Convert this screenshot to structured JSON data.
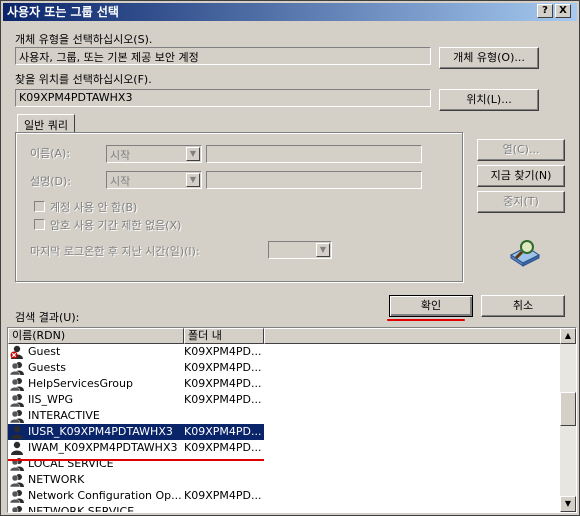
{
  "window": {
    "title": "사용자 또는 그룹 선택",
    "help_btn": "?",
    "close_btn": "X"
  },
  "object_type": {
    "label": "개체 유형을 선택하십시오(S).",
    "value": "사용자, 그룹, 또는 기본 제공 보안 계정",
    "button": "개체 유형(O)..."
  },
  "location": {
    "label": "찾을 위치를 선택하십시오(F).",
    "value": "K09XPM4PDTAWHX3",
    "button": "위치(L)..."
  },
  "query": {
    "tab": "일반 쿼리",
    "name_label": "이름(A):",
    "name_combo": "시작",
    "desc_label": "설명(D):",
    "desc_combo": "시작",
    "disabled_accounts": "계정 사용 안 함(B)",
    "non_expiring": "암호 사용 기간 제한 없음(X)",
    "last_logon": "마지막 로그온한 후 지난 시간(일)(I):"
  },
  "side_buttons": {
    "columns": "열(C)...",
    "find_now": "지금 찾기(N)",
    "stop": "중지(T)"
  },
  "footer": {
    "results_label": "검색 결과(U):",
    "ok": "확인",
    "cancel": "취소"
  },
  "results": {
    "columns": [
      "이름(RDN)",
      "폴더 내"
    ],
    "rows": [
      {
        "name": "Guest",
        "folder": "K09XPM4PD...",
        "icon": "user-disabled-icon"
      },
      {
        "name": "Guests",
        "folder": "K09XPM4PD...",
        "icon": "group-icon"
      },
      {
        "name": "HelpServicesGroup",
        "folder": "K09XPM4PD...",
        "icon": "group-icon"
      },
      {
        "name": "IIS_WPG",
        "folder": "K09XPM4PD...",
        "icon": "group-icon"
      },
      {
        "name": "INTERACTIVE",
        "folder": "",
        "icon": "group-icon"
      },
      {
        "name": "IUSR_K09XPM4PDTAWHX3",
        "folder": "K09XPM4PD...",
        "icon": "user-icon",
        "selected": true
      },
      {
        "name": "IWAM_K09XPM4PDTAWHX3",
        "folder": "K09XPM4PD...",
        "icon": "user-icon"
      },
      {
        "name": "LOCAL SERVICE",
        "folder": "",
        "icon": "group-icon"
      },
      {
        "name": "NETWORK",
        "folder": "",
        "icon": "group-icon"
      },
      {
        "name": "Network Configuration Op...",
        "folder": "K09XPM4PD...",
        "icon": "group-icon"
      },
      {
        "name": "NETWORK SERVICE",
        "folder": "",
        "icon": "group-icon"
      }
    ]
  },
  "colors": {
    "selection": "#0a246a",
    "annotation_red": "#e00000"
  }
}
